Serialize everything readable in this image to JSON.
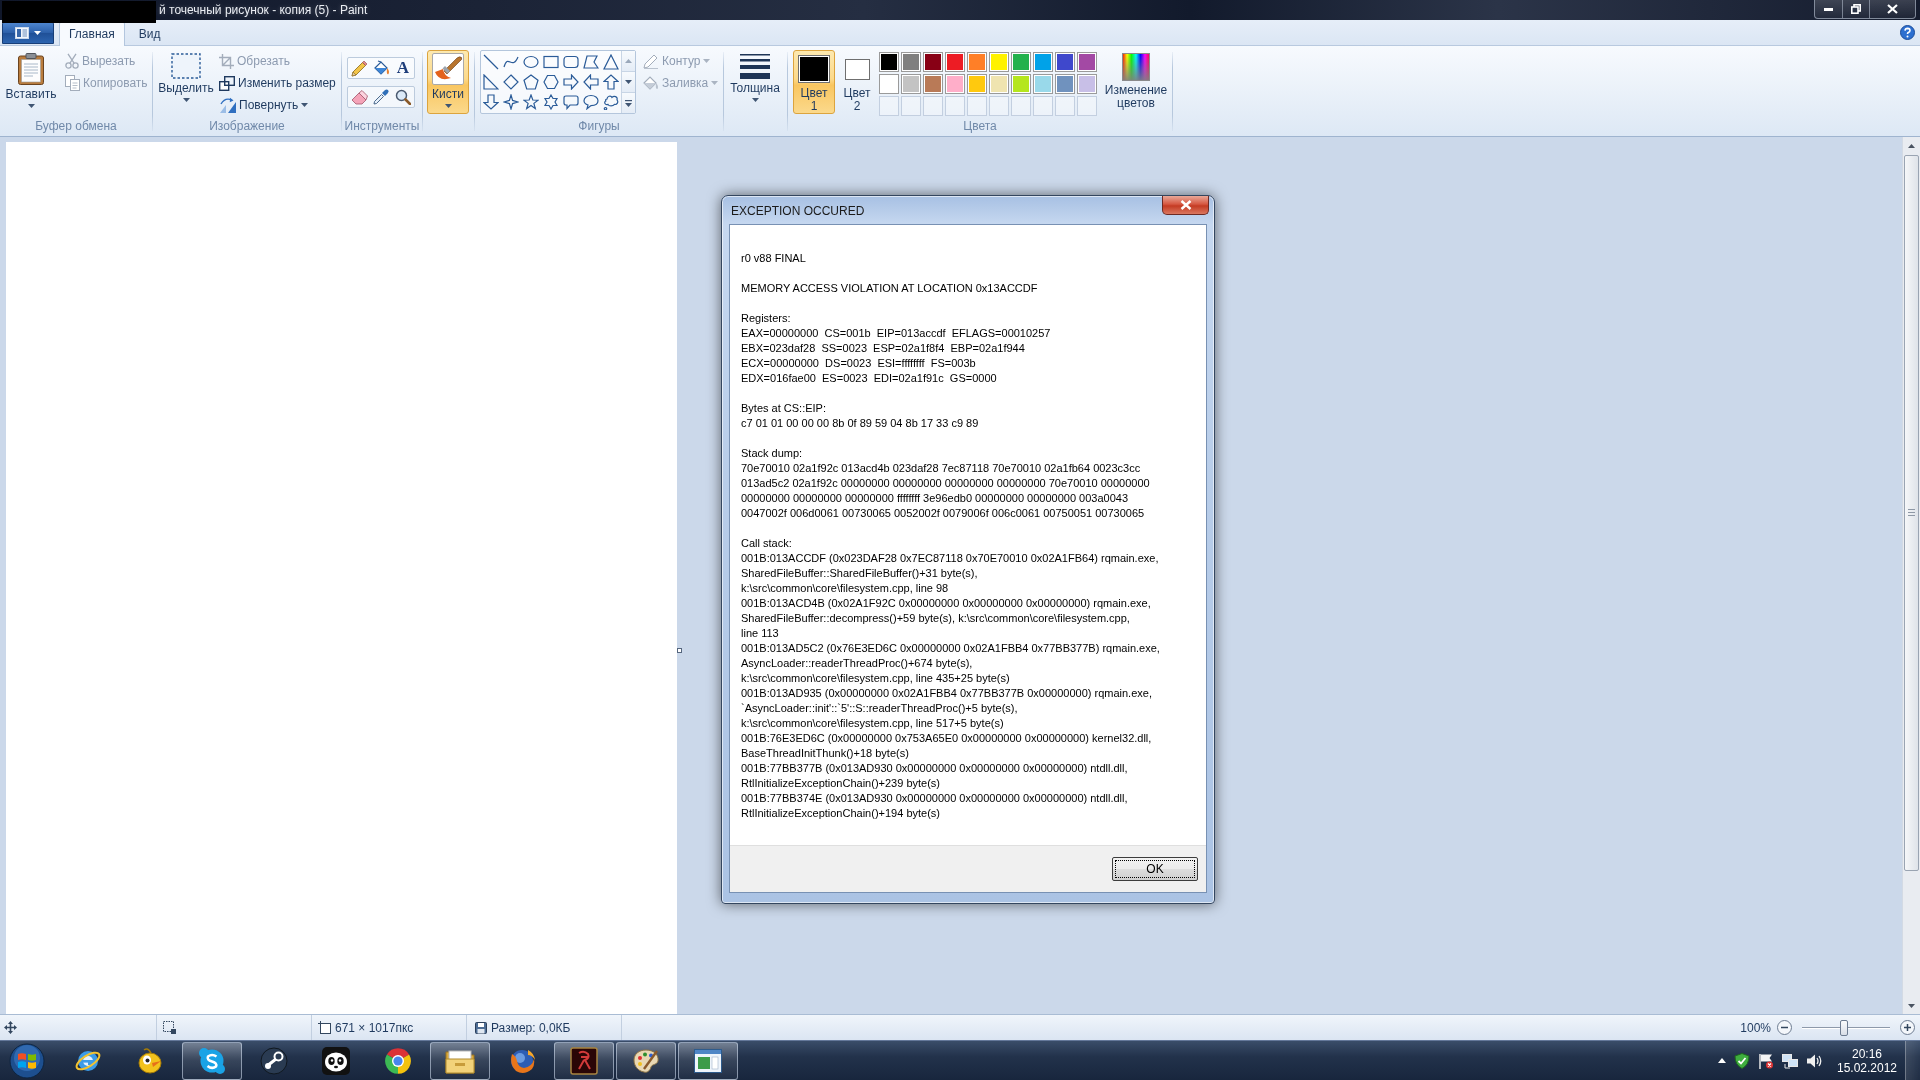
{
  "window": {
    "title": "й точечный рисунок - копия (5) - Paint"
  },
  "ribbon": {
    "tabs": [
      {
        "label": "Главная",
        "selected": true
      },
      {
        "label": "Вид",
        "selected": false
      }
    ],
    "clipboard": {
      "label": "Буфер обмена",
      "paste": "Вставить",
      "cut": {
        "label": "Вырезать",
        "disabled": true
      },
      "copy": {
        "label": "Копировать",
        "disabled": true
      }
    },
    "image": {
      "label": "Изображение",
      "select": "Выделить",
      "crop": {
        "label": "Обрезать",
        "disabled": true
      },
      "resize": {
        "label": "Изменить размер",
        "disabled": false
      },
      "rotate": {
        "label": "Повернуть",
        "disabled": false
      }
    },
    "tools": {
      "label": "Инструменты",
      "text_tool": "A"
    },
    "brushes": {
      "label": "Кисти",
      "selected": true
    },
    "shapes": {
      "label": "Фигуры",
      "outline": {
        "label": "Контур",
        "disabled": true
      },
      "fill": {
        "label": "Заливка",
        "disabled": true
      }
    },
    "size": {
      "label": "Толщина"
    },
    "colors": {
      "label": "Цвета",
      "slots": [
        {
          "label": "Цвет",
          "number": "1",
          "color": "#000000",
          "selected": true
        },
        {
          "label": "Цвет",
          "number": "2",
          "color": "#ffffff",
          "selected": false
        }
      ],
      "palette": [
        {
          "kind": "swatch",
          "color": "#000000"
        },
        {
          "kind": "swatch",
          "color": "#7f7f7f"
        },
        {
          "kind": "swatch",
          "color": "#880015"
        },
        {
          "kind": "swatch",
          "color": "#ed1c24"
        },
        {
          "kind": "swatch",
          "color": "#ff7f27"
        },
        {
          "kind": "swatch",
          "color": "#fff200"
        },
        {
          "kind": "swatch",
          "color": "#22b14c"
        },
        {
          "kind": "swatch",
          "color": "#00a2e8"
        },
        {
          "kind": "swatch",
          "color": "#3f48cc"
        },
        {
          "kind": "swatch",
          "color": "#a349a4"
        },
        {
          "kind": "swatch",
          "color": "#ffffff"
        },
        {
          "kind": "swatch",
          "color": "#c3c3c3"
        },
        {
          "kind": "swatch",
          "color": "#b97a57"
        },
        {
          "kind": "swatch",
          "color": "#ffaec9"
        },
        {
          "kind": "swatch",
          "color": "#ffc90e"
        },
        {
          "kind": "swatch",
          "color": "#efe4b0"
        },
        {
          "kind": "swatch",
          "color": "#b5e61d"
        },
        {
          "kind": "swatch",
          "color": "#99d9ea"
        },
        {
          "kind": "swatch",
          "color": "#7092be"
        },
        {
          "kind": "swatch",
          "color": "#c8bfe7"
        },
        {
          "kind": "empty"
        },
        {
          "kind": "empty"
        },
        {
          "kind": "empty"
        },
        {
          "kind": "empty"
        },
        {
          "kind": "empty"
        },
        {
          "kind": "empty"
        },
        {
          "kind": "empty"
        },
        {
          "kind": "empty"
        },
        {
          "kind": "empty"
        },
        {
          "kind": "empty"
        }
      ],
      "edit": "Изменение цветов"
    }
  },
  "status_bar": {
    "canvas_size": "671 × 1017пкс",
    "file_size": "Размер: 0,0КБ",
    "zoom": "100%",
    "zoom_slider": {
      "level": 0.48
    }
  },
  "dialog": {
    "title": "EXCEPTION OCCURED",
    "sections": [
      {
        "lines": [
          "r0 v88 FINAL"
        ]
      },
      {
        "lines": [
          "MEMORY ACCESS VIOLATION AT LOCATION 0x13ACCDF"
        ]
      },
      {
        "lines": [
          "Registers:",
          "EAX=00000000  CS=001b  EIP=013accdf  EFLAGS=00010257",
          "EBX=023daf28  SS=0023  ESP=02a1f8f4  EBP=02a1f944",
          "ECX=00000000  DS=0023  ESI=ffffffff  FS=003b",
          "EDX=016fae00  ES=0023  EDI=02a1f91c  GS=0000"
        ]
      },
      {
        "lines": [
          "Bytes at CS::EIP:",
          "c7 01 01 00 00 00 8b 0f 89 59 04 8b 17 33 c9 89"
        ]
      },
      {
        "lines": [
          "Stack dump:",
          "70e70010 02a1f92c 013acd4b 023daf28 7ec87118 70e70010 02a1fb64 0023c3cc",
          "013ad5c2 02a1f92c 00000000 00000000 00000000 00000000 70e70010 00000000",
          "00000000 00000000 00000000 ffffffff 3e96edb0 00000000 00000000 003a0043",
          "0047002f 006d0061 00730065 0052002f 0079006f 006c0061 00750051 00730065"
        ]
      },
      {
        "lines": [
          "Call stack:",
          "001B:013ACCDF (0x023DAF28 0x7EC87118 0x70E70010 0x02A1FB64) rqmain.exe,",
          "SharedFileBuffer::SharedFileBuffer()+31 byte(s),",
          "k:\\src\\common\\core\\filesystem.cpp, line 98",
          "001B:013ACD4B (0x02A1F92C 0x00000000 0x00000000 0x00000000) rqmain.exe,",
          "SharedFileBuffer::decompress()+59 byte(s), k:\\src\\common\\core\\filesystem.cpp,",
          "line 113",
          "001B:013AD5C2 (0x76E3ED6C 0x00000000 0x02A1FBB4 0x77BB377B) rqmain.exe,",
          "AsyncLoader::readerThreadProc()+674 byte(s),",
          "k:\\src\\common\\core\\filesystem.cpp, line 435+25 byte(s)",
          "001B:013AD935 (0x00000000 0x02A1FBB4 0x77BB377B 0x00000000) rqmain.exe,",
          "`AsyncLoader::init'::`5'::S::readerThreadProc()+5 byte(s),",
          "k:\\src\\common\\core\\filesystem.cpp, line 517+5 byte(s)",
          "001B:76E3ED6C (0x00000000 0x753A65E0 0x00000000 0x00000000) kernel32.dll,",
          "BaseThreadInitThunk()+18 byte(s)",
          "001B:77BB377B (0x013AD930 0x00000000 0x00000000 0x00000000) ntdll.dll,",
          "RtlInitializeExceptionChain()+239 byte(s)",
          "001B:77BB374E (0x013AD930 0x00000000 0x00000000 0x00000000) ntdll.dll,",
          "RtlInitializeExceptionChain()+194 byte(s)"
        ]
      }
    ],
    "button": "OK"
  },
  "taskbar": {
    "buttons": [
      {
        "kind": "globe",
        "running": false
      },
      {
        "kind": "bird",
        "running": false
      },
      {
        "kind": "cloud",
        "running": true
      },
      {
        "kind": "piston",
        "running": false
      },
      {
        "kind": "panda",
        "running": false
      },
      {
        "kind": "tricolor",
        "running": false
      },
      {
        "kind": "folder",
        "running": true
      },
      {
        "kind": "fox",
        "running": false
      },
      {
        "kind": "emblem",
        "running": true
      },
      {
        "kind": "palette",
        "running": true
      },
      {
        "kind": "window",
        "running": true
      }
    ],
    "clock": {
      "time": "20:16",
      "date": "15.02.2012"
    }
  }
}
